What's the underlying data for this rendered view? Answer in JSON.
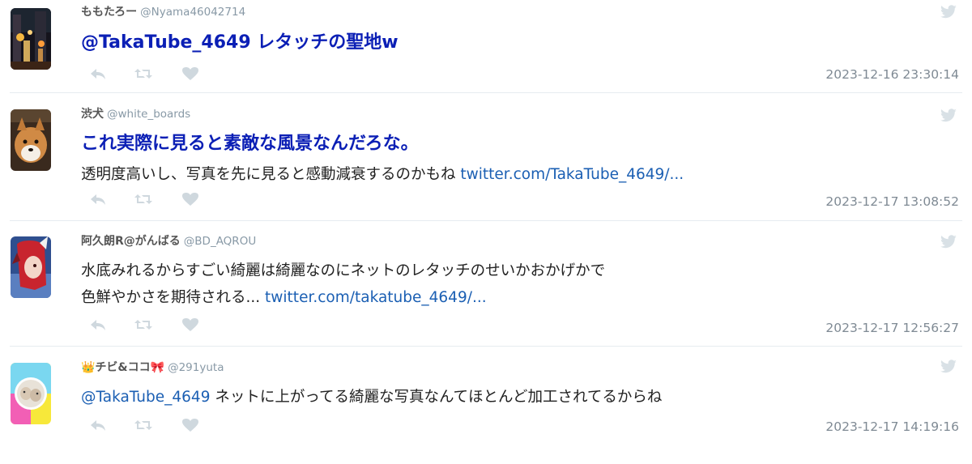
{
  "colors": {
    "accent": "#1b5fb3",
    "heading": "#0b1fb5",
    "muted": "#cfd8de"
  },
  "icons": {
    "reply": "reply-icon",
    "retweet": "retweet-icon",
    "like": "heart-icon",
    "bird": "twitter-bird-icon"
  },
  "tweets": [
    {
      "name": "ももたろー",
      "handle": "@Nyama46042714",
      "heading": "@TakaTube_4649 レタッチの聖地w",
      "text": "",
      "link": "",
      "time": "2023-12-16 23:30:14"
    },
    {
      "name": "渋犬",
      "handle": "@white_boards",
      "heading": "これ実際に見ると素敵な風景なんだろな。",
      "text": "透明度高いし、写真を先に見ると感動減衰するのかもね ",
      "link": "twitter.com/TakaTube_4649/...",
      "time": "2023-12-17 13:08:52"
    },
    {
      "name": "阿久朗R@がんばる",
      "handle": "@BD_AQROU",
      "heading": "",
      "text": "水底みれるからすごい綺麗は綺麗なのにネットのレタッチのせいかおかげかで",
      "text2": "色鮮やかさを期待される... ",
      "link": "twitter.com/takatube_4649/...",
      "time": "2023-12-17 12:56:27"
    },
    {
      "name": "チビ&ココ",
      "name_prefix": "👑",
      "name_suffix": "🎀",
      "handle": "@291yuta",
      "heading": "",
      "mention": "@TakaTube_4649",
      "text": " ネットに上がってる綺麗な写真なんてほとんど加工されてるからね",
      "link": "",
      "time": "2023-12-17 14:19:16"
    }
  ]
}
